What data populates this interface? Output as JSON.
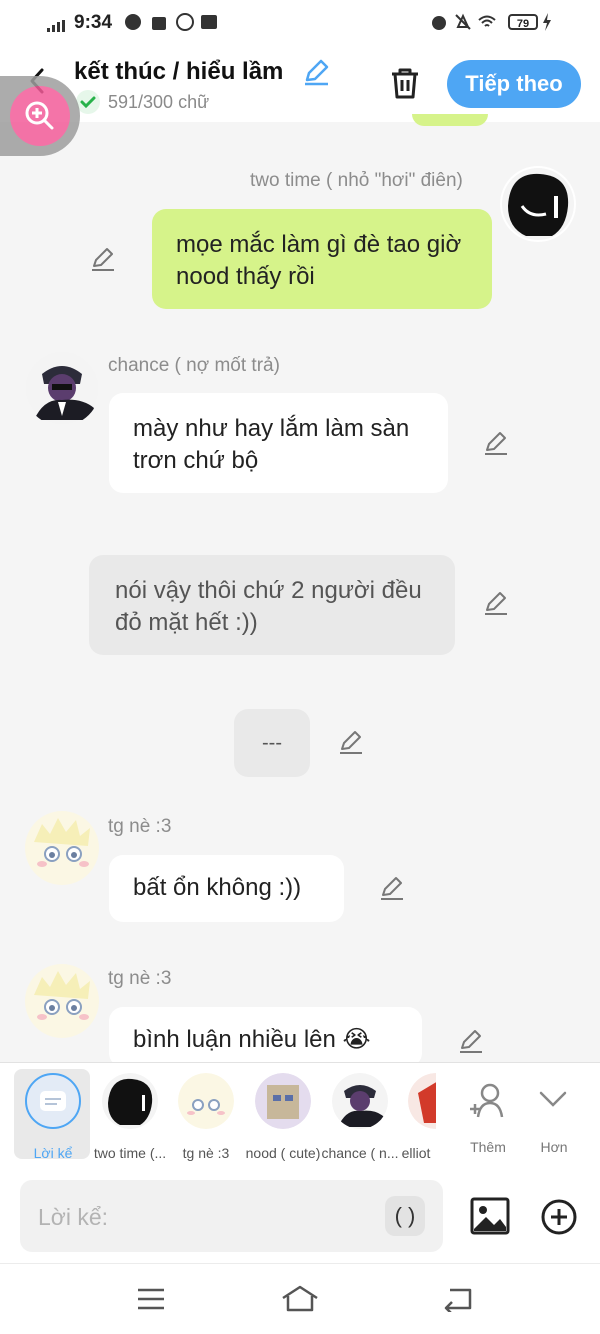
{
  "status": {
    "time": "9:34",
    "battery": "79"
  },
  "header": {
    "title": "kết thúc / hiểu lầm",
    "word_count": "591/300 chữ",
    "next_label": "Tiếp theo"
  },
  "messages": [
    {
      "speaker": "two time ( nhỏ \"hơi\" điên)",
      "text": "mọe mắc làm gì đè tao giờ nood thấy rồi"
    },
    {
      "speaker": "chance ( nợ mốt trả)",
      "text": "mày như hay lắm làm sàn trơn chứ bộ"
    },
    {
      "text": "nói vậy thôi chứ 2 người đều đỏ mặt hết :))"
    },
    {
      "text": "---"
    },
    {
      "speaker": "tg nè :3",
      "text": "bất ổn không :))"
    },
    {
      "speaker": "tg nè :3",
      "text": "bình luận nhiều lên 😭"
    }
  ],
  "characters": [
    {
      "label": "Lời kể"
    },
    {
      "label": "two time (..."
    },
    {
      "label": "tg nè :3"
    },
    {
      "label": "nood ( cute)"
    },
    {
      "label": "chance ( n..."
    },
    {
      "label": "elliot"
    }
  ],
  "actions": {
    "add_label": "Thêm",
    "more_label": "Hơn"
  },
  "input": {
    "placeholder": "Lời kể:",
    "paren_label": "( )"
  },
  "colors": {
    "accent": "#4ea6f4",
    "green_bubble": "#d6f38a",
    "zoom": "#f35c99"
  }
}
